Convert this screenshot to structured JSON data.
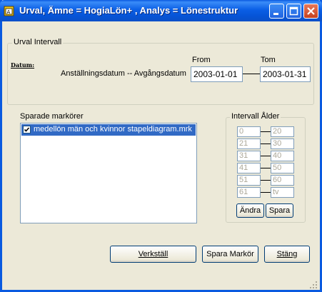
{
  "window": {
    "title": "Urval,  Ämne = HogiaLön+ ,  Analys = Lönestruktur"
  },
  "urval": {
    "group_label": "Urval Intervall",
    "datum_label": "Datum:",
    "field_label": "Anställningsdatum -- Avgångsdatum",
    "from_label": "From",
    "tom_label": "Tom",
    "from_value": "2003-01-01",
    "tom_value": "2003-01-31"
  },
  "markers": {
    "label": "Sparade markörer",
    "items": [
      {
        "label": "medellön män och kvinnor stapeldiagram.mrk",
        "checked": true
      }
    ]
  },
  "age": {
    "group_label": "Intervall Ålder",
    "rows": [
      {
        "from": "0",
        "to": "20"
      },
      {
        "from": "21",
        "to": "30"
      },
      {
        "from": "31",
        "to": "40"
      },
      {
        "from": "41",
        "to": "50"
      },
      {
        "from": "51",
        "to": "60"
      },
      {
        "from": "61",
        "to": "tv"
      }
    ],
    "edit_label": "Ändra",
    "save_label": "Spara"
  },
  "actions": {
    "apply_label": "Verkställ",
    "save_marker_label": "Spara Markör",
    "close_label": "Stäng"
  }
}
